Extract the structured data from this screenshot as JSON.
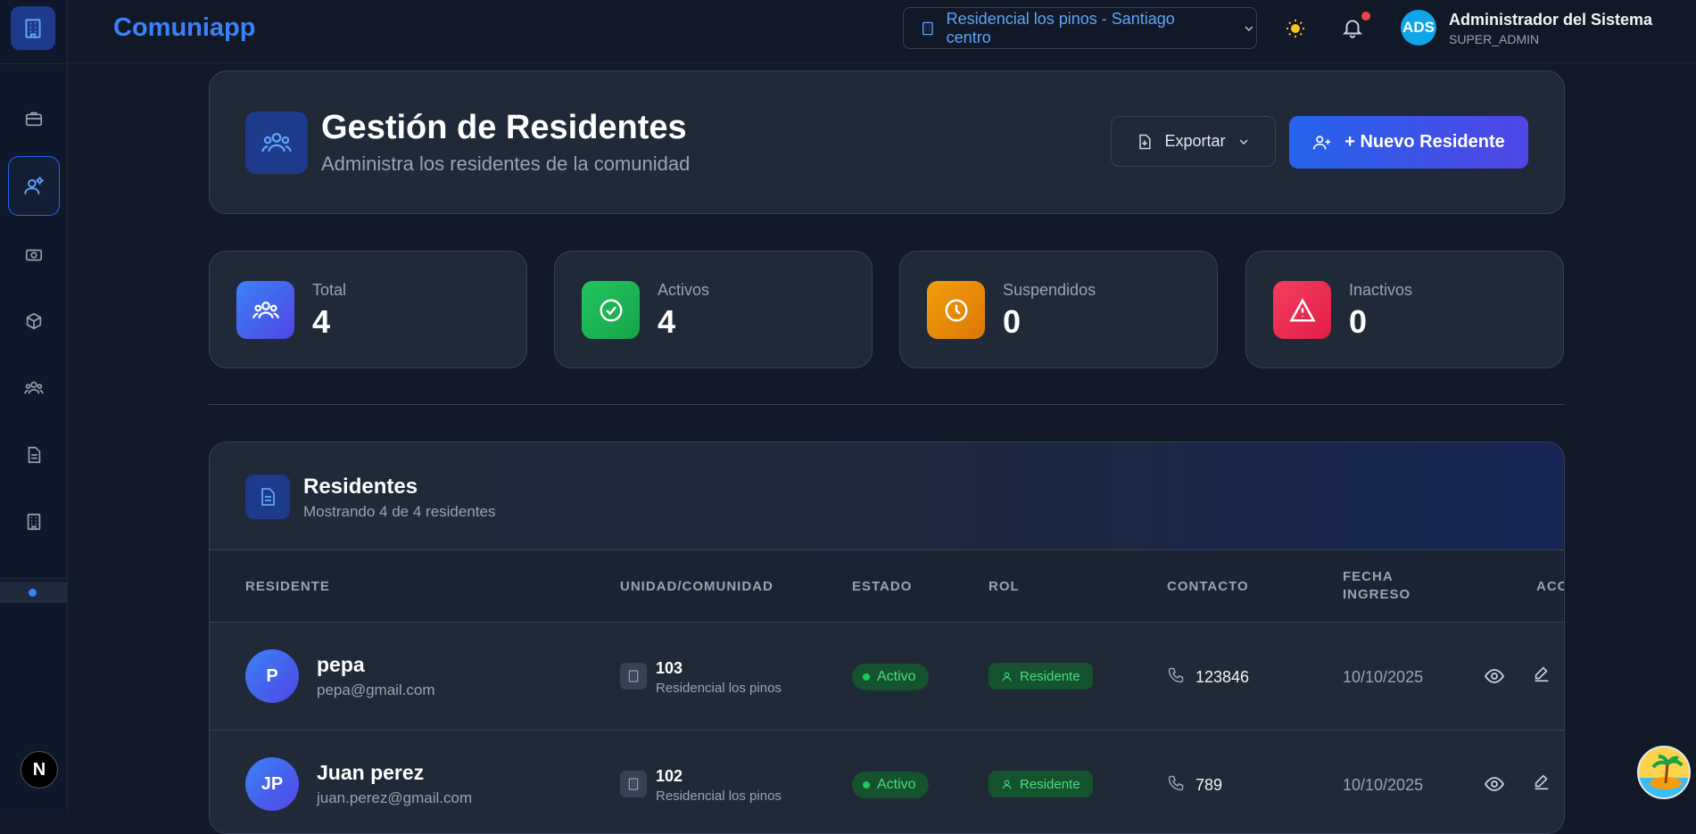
{
  "app": {
    "brand": "Comuniapp"
  },
  "topbar": {
    "community": "Residencial los pinos - Santiago centro",
    "user": {
      "initials": "ADS",
      "name": "Administrador del Sistema",
      "role": "SUPER_ADMIN"
    }
  },
  "sidebar": {
    "items": [
      {
        "icon": "briefcase-icon"
      },
      {
        "icon": "users-settings-icon",
        "active": true
      },
      {
        "icon": "money-icon"
      },
      {
        "icon": "box-icon"
      },
      {
        "icon": "users-icon"
      },
      {
        "icon": "document-icon"
      },
      {
        "icon": "building-icon"
      }
    ],
    "footer_badge": "N"
  },
  "header": {
    "title": "Gestión de Residentes",
    "subtitle": "Administra los residentes de la comunidad",
    "export_label": "Exportar",
    "new_label": "+ Nuevo Residente"
  },
  "stats": [
    {
      "label": "Total",
      "value": "4",
      "color": "#4f46e5"
    },
    {
      "label": "Activos",
      "value": "4",
      "color": "#16a34a"
    },
    {
      "label": "Suspendidos",
      "value": "0",
      "color": "#d97706"
    },
    {
      "label": "Inactivos",
      "value": "0",
      "color": "#e11d48"
    }
  ],
  "table": {
    "title": "Residentes",
    "subtitle": "Mostrando 4 de 4 residentes",
    "columns": [
      "RESIDENTE",
      "UNIDAD/COMUNIDAD",
      "ESTADO",
      "ROL",
      "CONTACTO",
      "FECHA",
      "INGRESO",
      "ACCI"
    ],
    "rows": [
      {
        "initials": "P",
        "name": "pepa",
        "email": "pepa@gmail.com",
        "unit": "103",
        "community": "Residencial los pinos",
        "status": "Activo",
        "role": "Residente",
        "contact": "123846",
        "date": "10/10/2025"
      },
      {
        "initials": "JP",
        "name": "Juan perez",
        "email": "juan.perez@gmail.com",
        "unit": "102",
        "community": "Residencial los pinos",
        "status": "Activo",
        "role": "Residente",
        "contact": "789",
        "date": "10/10/2025"
      }
    ]
  }
}
